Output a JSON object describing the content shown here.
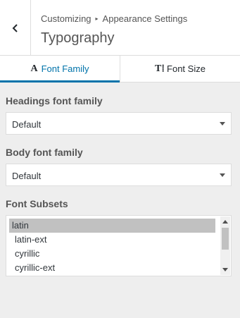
{
  "header": {
    "back_icon": "chevron-left-icon",
    "breadcrumb": {
      "first": "Customizing",
      "separator": "▸",
      "second": "Appearance Settings"
    },
    "title": "Typography"
  },
  "tabs": [
    {
      "glyph": "A",
      "label": "Font Family",
      "active": true
    },
    {
      "glyph": "T⁞",
      "label": "Font Size",
      "active": false
    }
  ],
  "headings_font": {
    "label": "Headings font family",
    "value": "Default"
  },
  "body_font": {
    "label": "Body font family",
    "value": "Default"
  },
  "font_subsets": {
    "label": "Font Subsets",
    "options": [
      "latin",
      "latin-ext",
      "cyrillic",
      "cyrillic-ext"
    ],
    "selected": "latin"
  },
  "colors": {
    "accent": "#0073aa",
    "panel_bg": "#eeeeee",
    "selected_bg": "#c1c1c1"
  }
}
